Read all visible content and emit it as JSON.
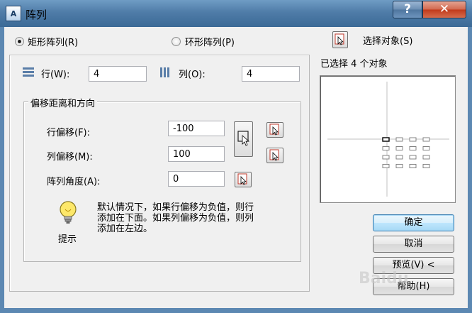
{
  "window": {
    "title": "阵列",
    "app_icon_text": "A",
    "help_symbol": "?",
    "close_symbol": "✕"
  },
  "mode": {
    "rect_label": "矩形阵列(R)",
    "polar_label": "环形阵列(P)",
    "selected": "rect"
  },
  "selection": {
    "button_label": "选择对象(S)",
    "status": "已选择 4 个对象"
  },
  "grid": {
    "rows_label": "行(W):",
    "rows_value": "4",
    "cols_label": "列(O):",
    "cols_value": "4"
  },
  "offset": {
    "group_label": "偏移距离和方向",
    "row_offset_label": "行偏移(F):",
    "row_offset_value": "-100",
    "col_offset_label": "列偏移(M):",
    "col_offset_value": "100",
    "angle_label": "阵列角度(A):",
    "angle_value": "0"
  },
  "tip": {
    "label": "提示",
    "text_line1": "默认情况下，如果行偏移为负值，则行",
    "text_line2": "添加在下面。如果列偏移为负值，则列",
    "text_line3": "添加在左边。"
  },
  "buttons": {
    "ok": "确定",
    "cancel": "取消",
    "preview": "预览(V) <",
    "help": "帮助(H)"
  },
  "watermark": "Baidu",
  "preview_layout": {
    "rows": 4,
    "cols": 4
  }
}
